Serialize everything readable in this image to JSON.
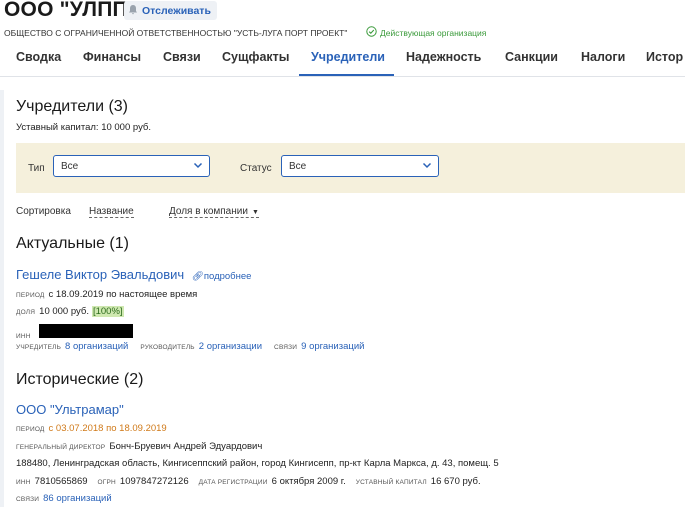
{
  "header": {
    "title": "ООО \"УЛПП\"",
    "watch_label": "Отслеживать",
    "full_name": "ОБЩЕСТВО С ОГРАНИЧЕННОЙ ОТВЕТСТВЕННОСТЬЮ \"УСТЬ-ЛУГА ПОРТ ПРОЕКТ\"",
    "status": "Действующая организация"
  },
  "tabs": [
    "Сводка",
    "Финансы",
    "Связи",
    "Сущфакты",
    "Учредители",
    "Надежность",
    "Санкции",
    "Налоги",
    "Истор"
  ],
  "active_tab": "Учредители",
  "main": {
    "heading": "Учредители (3)",
    "capital": "Уставный капитал: 10 000 руб.",
    "filters": {
      "type_label": "Тип",
      "type_value": "Все",
      "status_label": "Статус",
      "status_value": "Все"
    },
    "sort": {
      "label": "Сортировка",
      "option1": "Название",
      "option2": "Доля в компании"
    },
    "current": {
      "heading": "Актуальные (1)",
      "name": "Гешеле Виктор Эвальдович",
      "more": "подробнее",
      "period_label": "период",
      "period_value": "с 18.09.2019 по настоящее время",
      "share_label": "доля",
      "share_value": "10 000 руб.",
      "share_pct": "[100%]",
      "inn_label": "инн",
      "founder_label": "учредитель",
      "founder_link": "8 организаций",
      "manager_label": "руководитель",
      "manager_link": "2 организации",
      "links_label": "связи",
      "links_link": "9 организаций"
    },
    "historical": {
      "heading": "Исторические (2)",
      "name": "ООО \"Ультрамар\"",
      "period_label": "период",
      "period_value": "с 03.07.2018 по 18.09.2019",
      "director_label": "генеральный директор",
      "director_value": "Бонч-Бруевич Андрей Эдуардович",
      "address": "188480, Ленинградская область, Кингисеппский район, город Кингисепп, пр-кт Карла Маркса, д. 43, помещ. 5",
      "inn_label": "инн",
      "inn_value": "7810565869",
      "ogrn_label": "огрн",
      "ogrn_value": "1097847272126",
      "regdate_label": "дата регистрации",
      "regdate_value": "6 октября 2009 г.",
      "capital_label": "уставный капитал",
      "capital_value": "16 670 руб.",
      "links_label": "связи",
      "links_link": "86 организаций"
    }
  }
}
